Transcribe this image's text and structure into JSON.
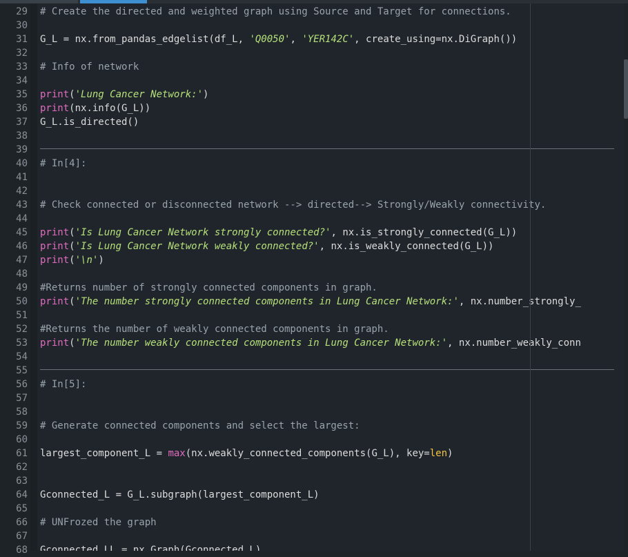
{
  "editor": {
    "lines": [
      {
        "no": "29",
        "segs": [
          {
            "t": "# Create the directed and weighted graph using Source and Target for connections.",
            "c": "c"
          }
        ]
      },
      {
        "no": "30",
        "segs": []
      },
      {
        "no": "31",
        "segs": [
          {
            "t": "G_L = nx.from_pandas_edgelist(df_L, ",
            "c": ""
          },
          {
            "t": "'Q0050'",
            "c": "s"
          },
          {
            "t": ", ",
            "c": ""
          },
          {
            "t": "'YER142C'",
            "c": "s"
          },
          {
            "t": ", create_using=nx.DiGraph())",
            "c": ""
          }
        ]
      },
      {
        "no": "32",
        "segs": []
      },
      {
        "no": "33",
        "segs": [
          {
            "t": "# Info of network",
            "c": "c"
          }
        ]
      },
      {
        "no": "34",
        "segs": []
      },
      {
        "no": "35",
        "segs": [
          {
            "t": "print",
            "c": "k"
          },
          {
            "t": "(",
            "c": ""
          },
          {
            "t": "'Lung Cancer Network:'",
            "c": "s"
          },
          {
            "t": ")",
            "c": ""
          }
        ]
      },
      {
        "no": "36",
        "segs": [
          {
            "t": "print",
            "c": "k"
          },
          {
            "t": "(nx.info(G_L))",
            "c": ""
          }
        ]
      },
      {
        "no": "37",
        "segs": [
          {
            "t": "G_L.is_directed()",
            "c": ""
          }
        ]
      },
      {
        "no": "38",
        "segs": []
      },
      {
        "no": "39",
        "segs": [],
        "sep": true
      },
      {
        "no": "40",
        "segs": [
          {
            "t": "# In[4]:",
            "c": "c"
          }
        ]
      },
      {
        "no": "41",
        "segs": []
      },
      {
        "no": "42",
        "segs": []
      },
      {
        "no": "43",
        "segs": [
          {
            "t": "# Check connected or disconnected network --> directed--> Strongly/Weakly connectivity.",
            "c": "c"
          }
        ]
      },
      {
        "no": "44",
        "segs": []
      },
      {
        "no": "45",
        "segs": [
          {
            "t": "print",
            "c": "k"
          },
          {
            "t": "(",
            "c": ""
          },
          {
            "t": "'Is Lung Cancer Network strongly connected?'",
            "c": "s"
          },
          {
            "t": ", nx.is_strongly_connected(G_L))",
            "c": ""
          }
        ]
      },
      {
        "no": "46",
        "segs": [
          {
            "t": "print",
            "c": "k"
          },
          {
            "t": "(",
            "c": ""
          },
          {
            "t": "'Is Lung Cancer Network weakly connected?'",
            "c": "s"
          },
          {
            "t": ", nx.is_weakly_connected(G_L))",
            "c": ""
          }
        ]
      },
      {
        "no": "47",
        "segs": [
          {
            "t": "print",
            "c": "k"
          },
          {
            "t": "(",
            "c": ""
          },
          {
            "t": "'\\n'",
            "c": "s"
          },
          {
            "t": ")",
            "c": ""
          }
        ]
      },
      {
        "no": "48",
        "segs": []
      },
      {
        "no": "49",
        "segs": [
          {
            "t": "#Returns number of strongly connected components in graph.",
            "c": "c"
          }
        ]
      },
      {
        "no": "50",
        "segs": [
          {
            "t": "print",
            "c": "k"
          },
          {
            "t": "(",
            "c": ""
          },
          {
            "t": "'The number strongly connected components in Lung Cancer Network:'",
            "c": "s"
          },
          {
            "t": ", nx.number_strongly_",
            "c": ""
          }
        ]
      },
      {
        "no": "51",
        "segs": []
      },
      {
        "no": "52",
        "segs": [
          {
            "t": "#Returns the number of weakly connected components in graph.",
            "c": "c"
          }
        ]
      },
      {
        "no": "53",
        "segs": [
          {
            "t": "print",
            "c": "k"
          },
          {
            "t": "(",
            "c": ""
          },
          {
            "t": "'The number weakly connected components in Lung Cancer Network:'",
            "c": "s"
          },
          {
            "t": ", nx.number_weakly_conn",
            "c": ""
          }
        ]
      },
      {
        "no": "54",
        "segs": []
      },
      {
        "no": "55",
        "segs": [],
        "sep": true
      },
      {
        "no": "56",
        "segs": [
          {
            "t": "# In[5]:",
            "c": "c"
          }
        ]
      },
      {
        "no": "57",
        "segs": []
      },
      {
        "no": "58",
        "segs": []
      },
      {
        "no": "59",
        "segs": [
          {
            "t": "# Generate connected components and select the largest:",
            "c": "c"
          }
        ]
      },
      {
        "no": "60",
        "segs": []
      },
      {
        "no": "61",
        "segs": [
          {
            "t": "largest_component_L = ",
            "c": ""
          },
          {
            "t": "max",
            "c": "k"
          },
          {
            "t": "(nx.weakly_connected_components(G_L), key=",
            "c": ""
          },
          {
            "t": "len",
            "c": "n"
          },
          {
            "t": ")",
            "c": ""
          }
        ]
      },
      {
        "no": "62",
        "segs": []
      },
      {
        "no": "63",
        "segs": []
      },
      {
        "no": "64",
        "segs": [
          {
            "t": "Gconnected_L = G_L.subgraph(largest_component_L)",
            "c": ""
          }
        ]
      },
      {
        "no": "65",
        "segs": []
      },
      {
        "no": "66",
        "segs": [
          {
            "t": "# UNFrozed the graph",
            "c": "c"
          }
        ]
      },
      {
        "no": "67",
        "segs": []
      },
      {
        "no": "68",
        "segs": [
          {
            "t": "Gconnected_LL = nx.Graph(Gconnected_L)",
            "c": ""
          }
        ]
      }
    ]
  }
}
